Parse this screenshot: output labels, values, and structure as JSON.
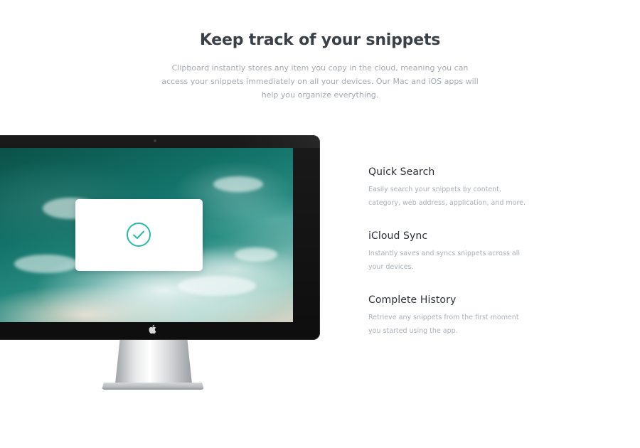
{
  "hero": {
    "title": "Keep track of your snippets",
    "description": "Clipboard instantly stores any item you copy in the cloud, meaning you can access your snippets immediately on all your devices. Our Mac and iOS apps will help you organize everything."
  },
  "monitor": {
    "confirmation_icon": "check-circle-icon",
    "logo_icon": "apple-logo-icon",
    "accent_color": "#26bba4"
  },
  "features": [
    {
      "title": "Quick Search",
      "description": "Easily search your snippets by content, category, web address, application, and more."
    },
    {
      "title": "iCloud Sync",
      "description": "Instantly saves and syncs snippets across all your devices."
    },
    {
      "title": "Complete History",
      "description": "Retrieve any snippets from the first moment you started using the app."
    }
  ],
  "colors": {
    "heading": "#3a4047",
    "body_text": "#a4abb2",
    "accent": "#26bba4"
  }
}
